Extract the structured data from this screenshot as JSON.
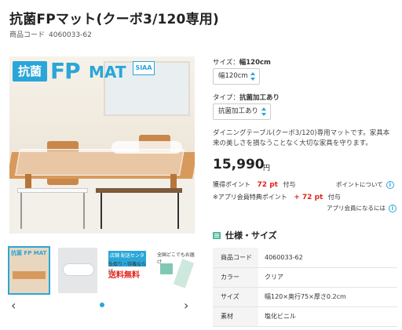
{
  "product": {
    "title": "抗菌FPマット(クーボ3/120専用)",
    "code_label": "商品コード",
    "code_value": "4060033-62"
  },
  "main_image": {
    "badge": "抗菌",
    "logo_fp": "FP",
    "logo_mat": "MAT",
    "logo_siaa": "SIAA"
  },
  "options": {
    "size_label": "サイズ：",
    "size_value": "幅120cm",
    "size_selected": "幅120cm",
    "type_label": "タイプ：",
    "type_value": "抗菌加工あり",
    "type_selected": "抗菌加工あり"
  },
  "description": "ダイニングテーブル(クーボ3/120)専用マットです。家具本来の美しさを損なうことなく大切な家具を守ります。",
  "price": {
    "amount": "15,990",
    "unit": "円"
  },
  "points": {
    "earn_label": "獲得ポイント",
    "earn_value": "72 pt",
    "earn_suffix": "付与",
    "about_link": "ポイントについて",
    "app_label": "※アプリ会員特典ポイント",
    "app_value": "+ 72 pt",
    "app_suffix": "付与",
    "app_member_link": "アプリ会員になるには"
  },
  "thumbnails": {
    "t1_label": "抗菌 FP MAT",
    "t3_badge": "店舗 配送センター",
    "t3_line": "受取り・待機ならば",
    "t3_free": "送料無料",
    "t4_text": "全国どこでもお届け"
  },
  "gallery_nav": {
    "prev": "‹",
    "next": "›"
  },
  "spec": {
    "heading": "仕様・サイズ",
    "rows": [
      {
        "key": "商品コード",
        "value": "4060033-62"
      },
      {
        "key": "カラー",
        "value": "クリア"
      },
      {
        "key": "サイズ",
        "value": "幅120×奥行75×厚さ0.2cm"
      },
      {
        "key": "素材",
        "value": "塩化ビニル"
      }
    ]
  },
  "colors": {
    "accent": "#2aa6d8",
    "price_red": "#e2231a",
    "spec_green": "#4db89a",
    "table_wood": "#d89a5c"
  }
}
